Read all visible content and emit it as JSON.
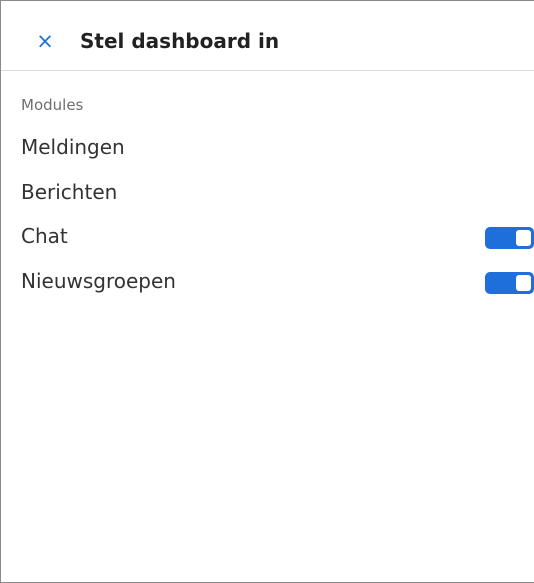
{
  "header": {
    "close_icon_glyph": "×",
    "title": "Stel dashboard in"
  },
  "modules": {
    "section_label": "Modules",
    "items": [
      {
        "label": "Meldingen",
        "toggle": null
      },
      {
        "label": "Berichten",
        "toggle": null
      },
      {
        "label": "Chat",
        "toggle": "on"
      },
      {
        "label": "Nieuwsgroepen",
        "toggle": "on"
      }
    ]
  },
  "colors": {
    "accent": "#1e6fd9",
    "text": "#333333",
    "muted": "#6f6f6f"
  }
}
